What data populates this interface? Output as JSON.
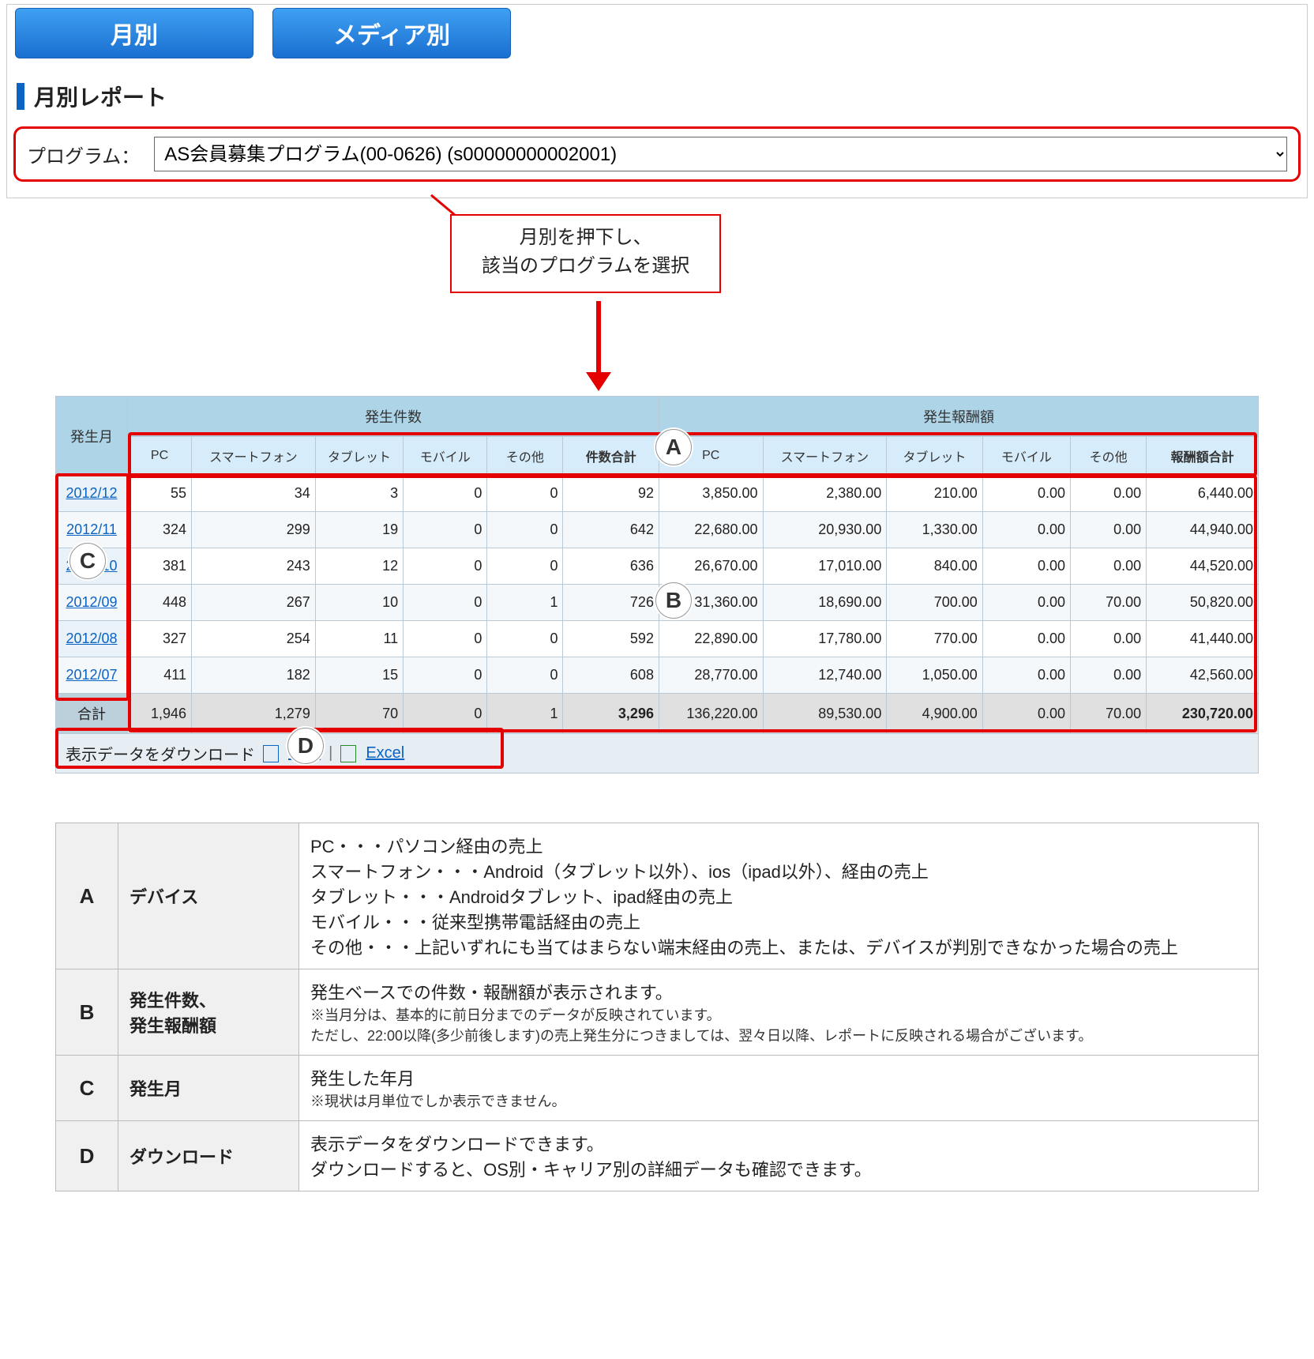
{
  "tabs": {
    "monthly": "月別",
    "by_media": "メディア別"
  },
  "section_title": "月別レポート",
  "program": {
    "label": "プログラム：",
    "selected": "AS会員募集プログラム(00-0626) (s00000000002001)"
  },
  "callout": {
    "line1": "月別を押下し、",
    "line2": "該当のプログラムを選択"
  },
  "report": {
    "group_headers": {
      "month": "発生月",
      "count": "発生件数",
      "reward": "発生報酬額"
    },
    "device_headers": [
      "PC",
      "スマートフォン",
      "タブレット",
      "モバイル",
      "その他"
    ],
    "sum_headers": {
      "count": "件数合計",
      "reward": "報酬額合計"
    },
    "rows": [
      {
        "month": "2012/12",
        "c": [
          "55",
          "34",
          "3",
          "0",
          "0"
        ],
        "csum": "92",
        "r": [
          "3,850.00",
          "2,380.00",
          "210.00",
          "0.00",
          "0.00"
        ],
        "rsum": "6,440.00"
      },
      {
        "month": "2012/11",
        "c": [
          "324",
          "299",
          "19",
          "0",
          "0"
        ],
        "csum": "642",
        "r": [
          "22,680.00",
          "20,930.00",
          "1,330.00",
          "0.00",
          "0.00"
        ],
        "rsum": "44,940.00"
      },
      {
        "month": "2012/10",
        "c": [
          "381",
          "243",
          "12",
          "0",
          "0"
        ],
        "csum": "636",
        "r": [
          "26,670.00",
          "17,010.00",
          "840.00",
          "0.00",
          "0.00"
        ],
        "rsum": "44,520.00"
      },
      {
        "month": "2012/09",
        "c": [
          "448",
          "267",
          "10",
          "0",
          "1"
        ],
        "csum": "726",
        "r": [
          "31,360.00",
          "18,690.00",
          "700.00",
          "0.00",
          "70.00"
        ],
        "rsum": "50,820.00"
      },
      {
        "month": "2012/08",
        "c": [
          "327",
          "254",
          "11",
          "0",
          "0"
        ],
        "csum": "592",
        "r": [
          "22,890.00",
          "17,780.00",
          "770.00",
          "0.00",
          "0.00"
        ],
        "rsum": "41,440.00"
      },
      {
        "month": "2012/07",
        "c": [
          "411",
          "182",
          "15",
          "0",
          "0"
        ],
        "csum": "608",
        "r": [
          "28,770.00",
          "12,740.00",
          "1,050.00",
          "0.00",
          "0.00"
        ],
        "rsum": "42,560.00"
      }
    ],
    "total": {
      "label": "合計",
      "c": [
        "1,946",
        "1,279",
        "70",
        "0",
        "1"
      ],
      "csum": "3,296",
      "r": [
        "136,220.00",
        "89,530.00",
        "4,900.00",
        "0.00",
        "70.00"
      ],
      "rsum": "230,720.00"
    }
  },
  "download": {
    "label": "表示データをダウンロード",
    "csv": "CSV",
    "excel": "Excel",
    "sep": "|"
  },
  "markers": {
    "A": "A",
    "B": "B",
    "C": "C",
    "D": "D"
  },
  "legend": [
    {
      "letter": "A",
      "name": "デバイス",
      "lines": [
        "PC・・・パソコン経由の売上",
        "スマートフォン・・・Android（タブレット以外）、ios（ipad以外）、経由の売上",
        "タブレット・・・Androidタブレット、ipad経由の売上",
        "モバイル・・・従来型携帯電話経由の売上",
        "その他・・・上記いずれにも当てはまらない端末経由の売上、または、デバイスが判別できなかった場合の売上"
      ]
    },
    {
      "letter": "B",
      "name": "発生件数、\n発生報酬額",
      "lines": [
        "発生ベースでの件数・報酬額が表示されます。"
      ],
      "sublines": [
        "※当月分は、基本的に前日分までのデータが反映されています。",
        "ただし、22:00以降(多少前後します)の売上発生分につきましては、翌々日以降、レポートに反映される場合がございます。"
      ]
    },
    {
      "letter": "C",
      "name": "発生月",
      "lines": [
        "発生した年月"
      ],
      "sublines": [
        "※現状は月単位でしか表示できません。"
      ]
    },
    {
      "letter": "D",
      "name": "ダウンロード",
      "lines": [
        "表示データをダウンロードできます。",
        "ダウンロードすると、OS別・キャリア別の詳細データも確認できます。"
      ]
    }
  ]
}
